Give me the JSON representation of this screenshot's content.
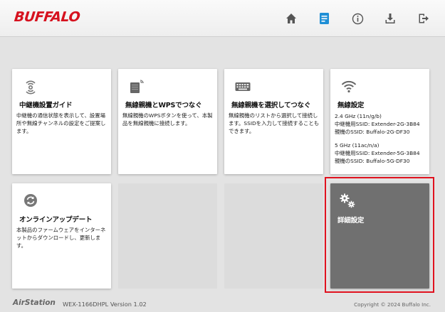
{
  "header": {
    "logo": "BUFFALO",
    "nav": [
      "home-icon",
      "settings-doc-icon",
      "info-icon",
      "download-icon",
      "logout-icon"
    ],
    "accent": "#1f8fd6",
    "brand_color": "#d6121f"
  },
  "tiles": [
    {
      "title": "中継機設置ガイド",
      "desc": "中継機の通信状態を表示して、設置場所や無線チャンネルの設定をご提案します。",
      "icon": "signal-locate-icon"
    },
    {
      "title": "無線親機とWPSでつなぐ",
      "desc": "無線親機のWPSボタンを使って、本製品を無線親機に接続します。",
      "icon": "router-wps-icon"
    },
    {
      "title": "無線親機を選択してつなぐ",
      "desc": "無線親機のリストから選択して接続します。SSIDを入力して接続することもできます。",
      "icon": "keyboard-icon"
    },
    {
      "title": "無線設定",
      "icon": "wifi-icon",
      "bands": [
        {
          "band": "2.4 GHz (11n/g/b)",
          "ext": "中継機用SSID: Extender-2G-3B84",
          "parent": "親機のSSID: Buffalo-2G-DF30"
        },
        {
          "band": "5 GHz (11ac/n/a)",
          "ext": "中継機用SSID: Extender-5G-3B84",
          "parent": "親機のSSID: Buffalo-5G-DF30"
        }
      ]
    },
    {
      "title": "オンラインアップデート",
      "desc": "本製品のファームウェアをインターネットからダウンロードし、更新します。",
      "icon": "refresh-icon"
    },
    {
      "title": "詳細設定",
      "icon": "gears-icon",
      "bg": "#707070"
    }
  ],
  "footer": {
    "brand": "AirStation",
    "model": "WEX-1166DHPL Version 1.02",
    "copyright": "Copyright © 2024 Buffalo Inc."
  },
  "highlight_color": "#e0121f"
}
